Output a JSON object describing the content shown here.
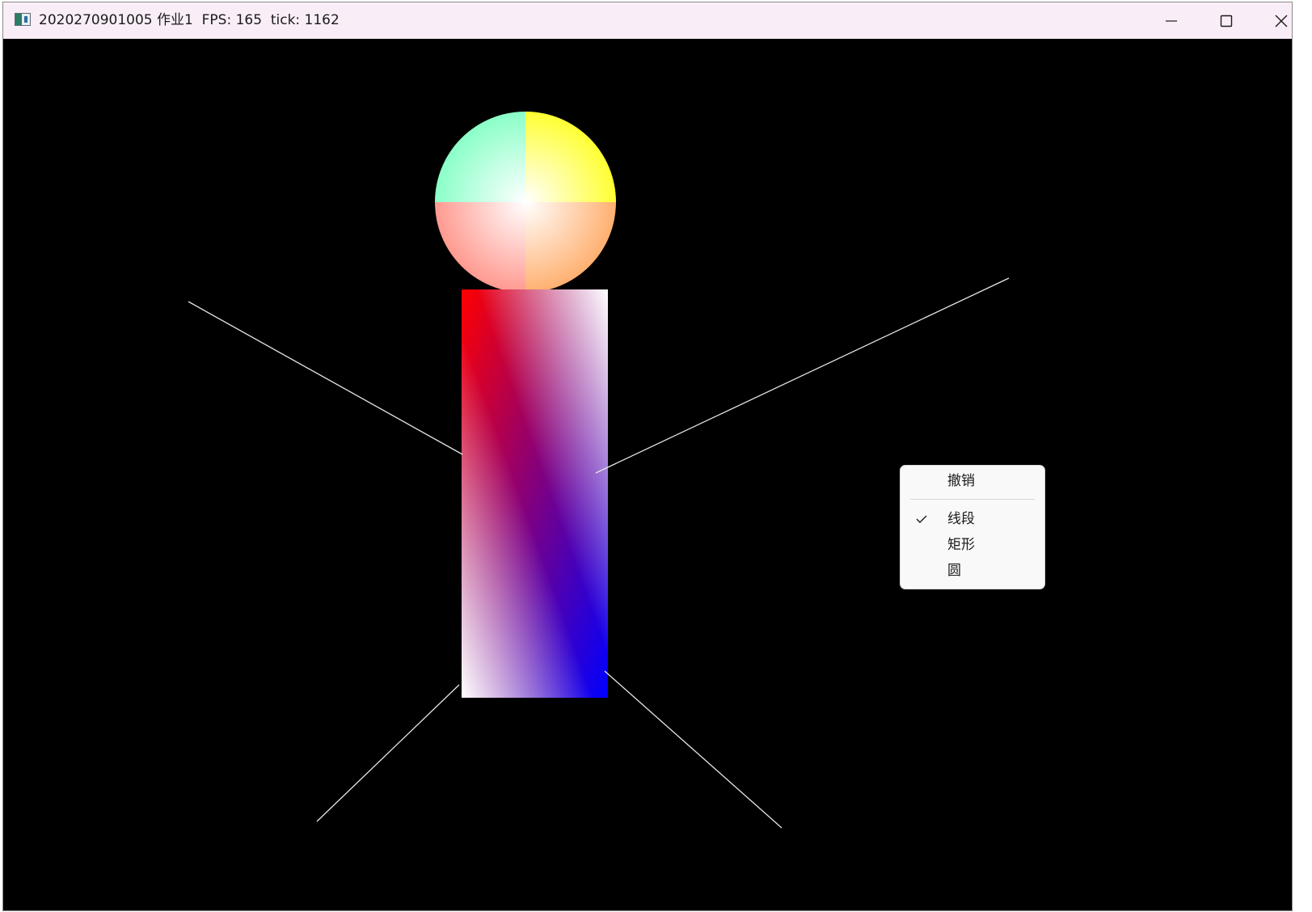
{
  "window": {
    "title": "2020270901005 作业1  FPS: 165  tick: 1162",
    "icon": "app-window-icon",
    "controls": {
      "minimize_icon": "minimize-icon",
      "maximize_icon": "maximize-icon",
      "close_icon": "close-icon"
    }
  },
  "canvas": {
    "background": "#000000",
    "shapes": [
      {
        "kind": "circle",
        "name": "head",
        "colors": [
          "#ffff33",
          "#ffffff",
          "#ff8080",
          "#80ffc0"
        ]
      },
      {
        "kind": "rectangle",
        "name": "body",
        "colors": [
          "#ff0000",
          "#ffffff",
          "#0000ff",
          "#800080"
        ]
      },
      {
        "kind": "line",
        "name": "left-arm",
        "color": "#ffffff"
      },
      {
        "kind": "line",
        "name": "right-arm",
        "color": "#ffffff"
      },
      {
        "kind": "line",
        "name": "left-leg",
        "color": "#ffffff"
      },
      {
        "kind": "line",
        "name": "right-leg",
        "color": "#ffffff"
      }
    ]
  },
  "context_menu": {
    "undo_label": "撤销",
    "items": [
      {
        "label": "线段",
        "checked": true
      },
      {
        "label": "矩形",
        "checked": false
      },
      {
        "label": "圆",
        "checked": false
      }
    ],
    "check_icon": "checkmark-icon"
  }
}
